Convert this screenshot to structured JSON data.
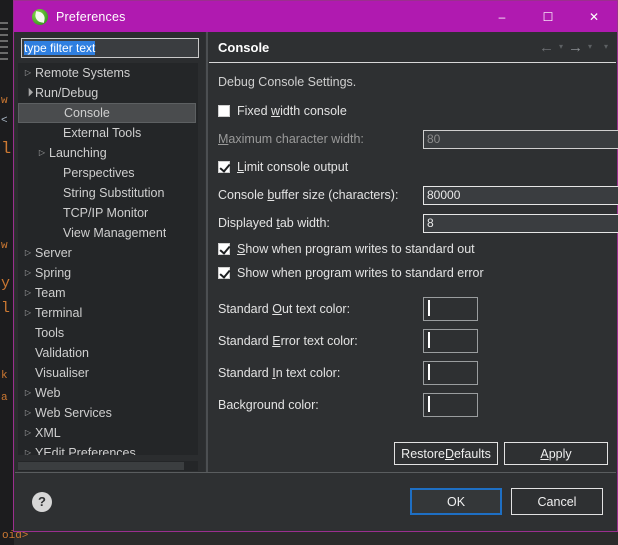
{
  "window": {
    "title": "Preferences",
    "icon": "spring-leaf-icon",
    "controls": {
      "minimize": "–",
      "maximize": "☐",
      "close": "✕"
    },
    "titlebar_color": "#b01ab0",
    "border_color": "#9b2f8e"
  },
  "background": {
    "tokens": [
      "w",
      "<",
      "l",
      "w",
      "y",
      "l",
      "k",
      "a"
    ],
    "bottom_text": "oid>"
  },
  "sidebar": {
    "filter": {
      "value": "type filter text",
      "placeholder": "type filter text",
      "selected": true
    },
    "items": [
      {
        "label": "Remote Systems",
        "indent": 0,
        "twisty": "collapsed",
        "selected": false
      },
      {
        "label": "Run/Debug",
        "indent": 0,
        "twisty": "expanded",
        "selected": false
      },
      {
        "label": "Console",
        "indent": 2,
        "twisty": "none",
        "selected": true
      },
      {
        "label": "External Tools",
        "indent": 2,
        "twisty": "none",
        "selected": false
      },
      {
        "label": "Launching",
        "indent": 1,
        "twisty": "collapsed",
        "selected": false
      },
      {
        "label": "Perspectives",
        "indent": 2,
        "twisty": "none",
        "selected": false
      },
      {
        "label": "String Substitution",
        "indent": 2,
        "twisty": "none",
        "selected": false
      },
      {
        "label": "TCP/IP Monitor",
        "indent": 2,
        "twisty": "none",
        "selected": false
      },
      {
        "label": "View Management",
        "indent": 2,
        "twisty": "none",
        "selected": false
      },
      {
        "label": "Server",
        "indent": 0,
        "twisty": "collapsed",
        "selected": false
      },
      {
        "label": "Spring",
        "indent": 0,
        "twisty": "collapsed",
        "selected": false
      },
      {
        "label": "Team",
        "indent": 0,
        "twisty": "collapsed",
        "selected": false
      },
      {
        "label": "Terminal",
        "indent": 0,
        "twisty": "collapsed",
        "selected": false
      },
      {
        "label": "Tools",
        "indent": 0,
        "twisty": "none",
        "selected": false
      },
      {
        "label": "Validation",
        "indent": 0,
        "twisty": "none",
        "selected": false
      },
      {
        "label": "Visualiser",
        "indent": 0,
        "twisty": "none",
        "selected": false
      },
      {
        "label": "Web",
        "indent": 0,
        "twisty": "collapsed",
        "selected": false
      },
      {
        "label": "Web Services",
        "indent": 0,
        "twisty": "collapsed",
        "selected": false
      },
      {
        "label": "XML",
        "indent": 0,
        "twisty": "collapsed",
        "selected": false
      },
      {
        "label": "YEdit Preferences",
        "indent": 0,
        "twisty": "collapsed",
        "selected": false
      }
    ]
  },
  "page": {
    "title": "Console",
    "nav": {
      "back": "←",
      "back_caret": "▾",
      "forward": "→",
      "forward_caret": "▾",
      "menu_caret": "▾"
    },
    "section_note": "Debug Console Settings.",
    "checkboxes": [
      {
        "label": "Fixed width console",
        "mnemonic": "w",
        "checked": false
      },
      {
        "label": "Limit console output",
        "mnemonic": "L",
        "checked": true
      },
      {
        "label": "Show when program writes to standard out",
        "mnemonic": "S",
        "checked": true
      },
      {
        "label": "Show when program writes to standard error",
        "mnemonic": "p",
        "checked": true
      }
    ],
    "fields": [
      {
        "label": "Maximum character width:",
        "mnemonic": "M",
        "value": "80",
        "disabled": true
      },
      {
        "label": "Console buffer size (characters):",
        "mnemonic": "b",
        "value": "80000",
        "disabled": false
      },
      {
        "label": "Displayed tab width:",
        "mnemonic": "t",
        "value": "8",
        "disabled": false
      }
    ],
    "colors": [
      {
        "label": "Standard Out text color:",
        "mnemonic": "O",
        "color": "#1a85e8"
      },
      {
        "label": "Standard Error text color:",
        "mnemonic": "E",
        "color": "#ef0f53"
      },
      {
        "label": "Standard In text color:",
        "mnemonic": "I",
        "color": "#0a8216"
      },
      {
        "label": "Background color:",
        "mnemonic": "g",
        "color": "#242628"
      }
    ],
    "buttons": {
      "restore_defaults": "Restore Defaults",
      "restore_defaults_mnemonic": "D",
      "apply": "Apply",
      "apply_mnemonic": "A"
    }
  },
  "footer": {
    "help": "?",
    "ok": "OK",
    "cancel": "Cancel",
    "default_button": "OK",
    "focus_color": "#1e6fc4"
  }
}
